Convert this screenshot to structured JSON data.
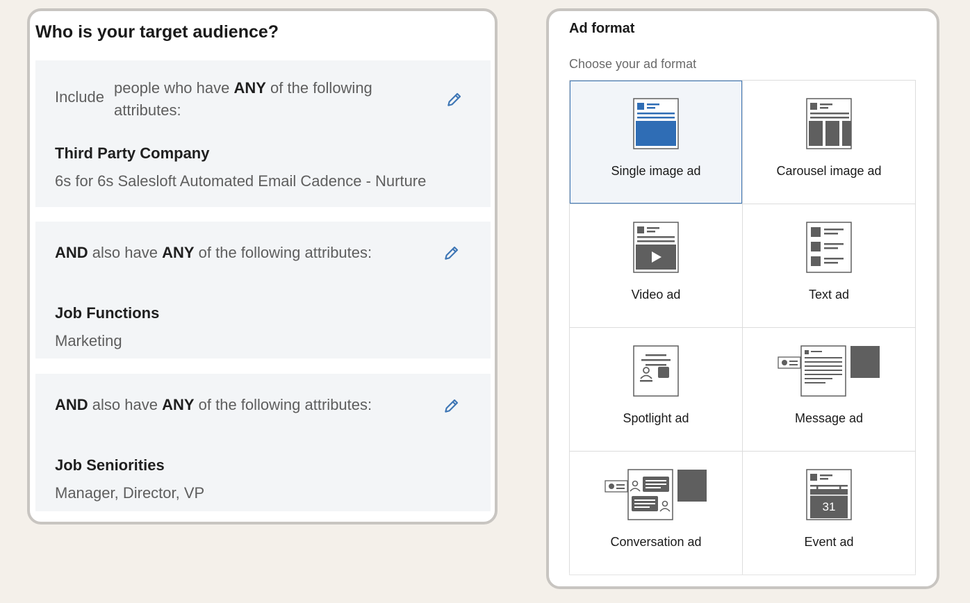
{
  "audience": {
    "title": "Who is your target audience?",
    "include_label": "Include",
    "include_text_pre": "people who have ",
    "include_text_any": "ANY",
    "include_text_post": " of the following attributes:",
    "groups": [
      {
        "name": "Third Party Company",
        "value": "6s for 6s Salesloft Automated Email Cadence - Nurture"
      },
      {
        "name": "Job Functions",
        "value": "Marketing"
      },
      {
        "name": "Job Seniorities",
        "value": "Manager, Director, VP"
      }
    ],
    "and_word": "AND",
    "also_have": " also have ",
    "any_word": "ANY",
    "of_following": " of the following attributes:",
    "edit_icon": "pencil-icon"
  },
  "ad_format": {
    "title": "Ad format",
    "subtitle": "Choose your ad format",
    "selected": "Single image ad",
    "formats": [
      {
        "label": "Single image ad",
        "icon": "single-image-ad-icon"
      },
      {
        "label": "Carousel image ad",
        "icon": "carousel-image-ad-icon"
      },
      {
        "label": "Video ad",
        "icon": "video-ad-icon"
      },
      {
        "label": "Text ad",
        "icon": "text-ad-icon"
      },
      {
        "label": "Spotlight ad",
        "icon": "spotlight-ad-icon"
      },
      {
        "label": "Message ad",
        "icon": "message-ad-icon"
      },
      {
        "label": "Conversation ad",
        "icon": "conversation-ad-icon"
      },
      {
        "label": "Event ad",
        "icon": "event-ad-icon"
      }
    ],
    "event_day": "31"
  },
  "colors": {
    "accent_blue": "#3e76b5",
    "icon_gray": "#5f5f5f",
    "page_bg": "#f4f0ea",
    "panel_border": "#c8c5c1"
  }
}
